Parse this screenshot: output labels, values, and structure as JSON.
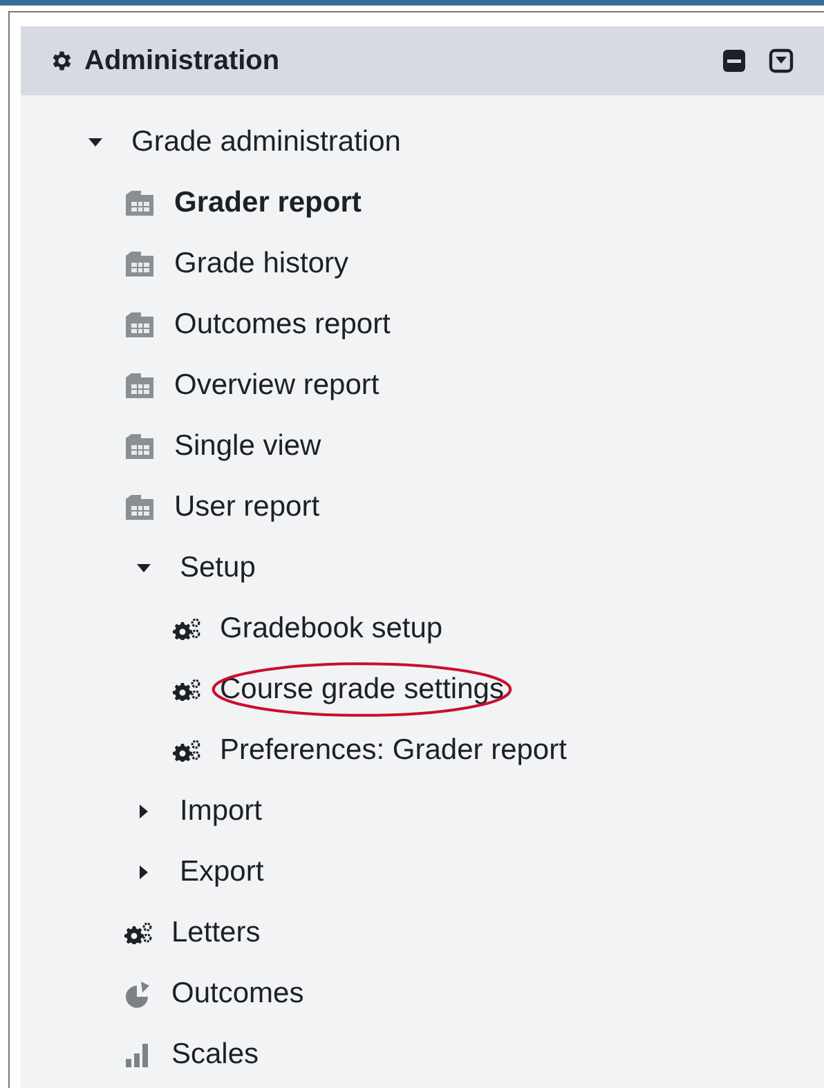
{
  "block": {
    "title": "Administration"
  },
  "tree": [
    {
      "label": "Grade administration",
      "kind": "folder",
      "expanded": true,
      "selected": false,
      "circled": false,
      "children": [
        {
          "label": "Grader report",
          "kind": "report",
          "selected": true,
          "circled": false
        },
        {
          "label": "Grade history",
          "kind": "report",
          "selected": false,
          "circled": false
        },
        {
          "label": "Outcomes report",
          "kind": "report",
          "selected": false,
          "circled": false
        },
        {
          "label": "Overview report",
          "kind": "report",
          "selected": false,
          "circled": false
        },
        {
          "label": "Single view",
          "kind": "report",
          "selected": false,
          "circled": false
        },
        {
          "label": "User report",
          "kind": "report",
          "selected": false,
          "circled": false
        },
        {
          "label": "Setup",
          "kind": "folder",
          "expanded": true,
          "selected": false,
          "circled": false,
          "children": [
            {
              "label": "Gradebook setup",
              "kind": "settings",
              "selected": false,
              "circled": false
            },
            {
              "label": "Course grade settings",
              "kind": "settings",
              "selected": false,
              "circled": true
            },
            {
              "label": "Preferences: Grader report",
              "kind": "settings",
              "selected": false,
              "circled": false
            }
          ]
        },
        {
          "label": "Import",
          "kind": "folder",
          "expanded": false,
          "selected": false,
          "circled": false
        },
        {
          "label": "Export",
          "kind": "folder",
          "expanded": false,
          "selected": false,
          "circled": false
        },
        {
          "label": "Letters",
          "kind": "settings",
          "selected": false,
          "circled": false
        },
        {
          "label": "Outcomes",
          "kind": "outcomes",
          "selected": false,
          "circled": false
        },
        {
          "label": "Scales",
          "kind": "scales",
          "selected": false,
          "circled": false
        }
      ]
    }
  ]
}
